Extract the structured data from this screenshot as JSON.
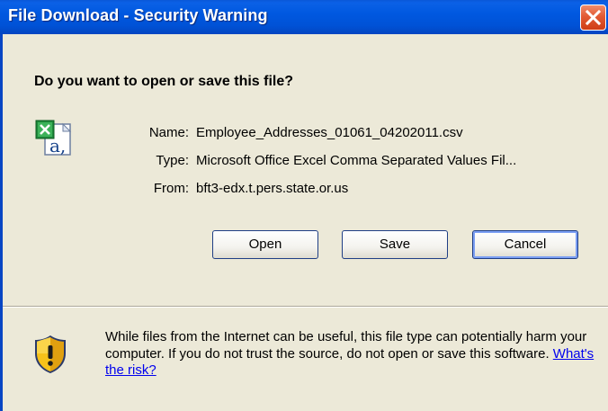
{
  "window": {
    "title": "File Download - Security Warning",
    "close_icon": "close-icon"
  },
  "dialog": {
    "question": "Do you want to open or save this file?",
    "file_icon": "excel-csv-file-icon",
    "fields": {
      "name_label": "Name:",
      "name_value": "Employee_Addresses_01061_04202011.csv",
      "type_label": "Type:",
      "type_value": "Microsoft Office Excel Comma Separated Values Fil...",
      "from_label": "From:",
      "from_value": "bft3-edx.t.pers.state.or.us"
    },
    "buttons": {
      "open": "Open",
      "save": "Save",
      "cancel": "Cancel"
    },
    "warning": {
      "icon": "security-shield-icon",
      "text": "While files from the Internet can be useful, this file type can potentially harm your computer. If you do not trust the source, do not open or save this software.",
      "link": "What's the risk?"
    }
  },
  "colors": {
    "titlebar": "#0054e3",
    "dialog_bg": "#ece9d8",
    "close_button": "#e2582f",
    "link": "#0000ee"
  }
}
